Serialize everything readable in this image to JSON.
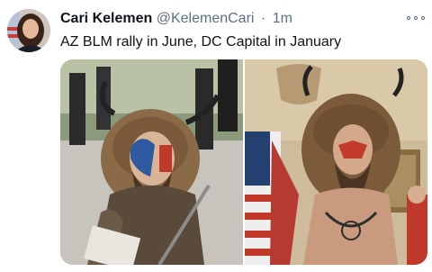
{
  "tweet": {
    "display_name": "Cari Kelemen",
    "handle": "@KelemenCari",
    "separator": "·",
    "timestamp": "1m",
    "text": "AZ BLM rally in June, DC Capital in January"
  },
  "icons": {
    "more": "more-options-icon"
  },
  "media": {
    "count": 2
  }
}
